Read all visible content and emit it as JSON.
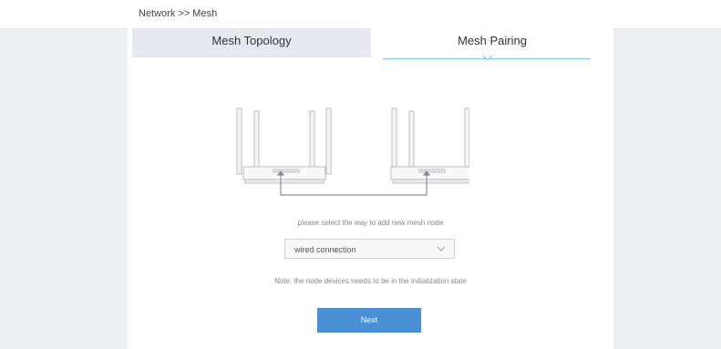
{
  "breadcrumb": "Network >> Mesh",
  "tabs": [
    {
      "label": "Mesh Topology",
      "active": false
    },
    {
      "label": "Mesh Pairing",
      "active": true
    }
  ],
  "pairing": {
    "prompt": "please select the way to add new mesh node",
    "select_value": "wired connection",
    "note": "Note: the node devices needs to be in the initialization state",
    "next_label": "Next"
  },
  "colors": {
    "accent": "#4a8fd6",
    "tab_inactive_bg": "#e6e9ef",
    "underline": "#7cc0ea",
    "page_bg": "#edf0f3"
  },
  "icons": {
    "illustration": "two-routers-wired-diagram",
    "select_arrow": "chevron-down-icon",
    "tab_indicator": "caret-down-icon"
  }
}
